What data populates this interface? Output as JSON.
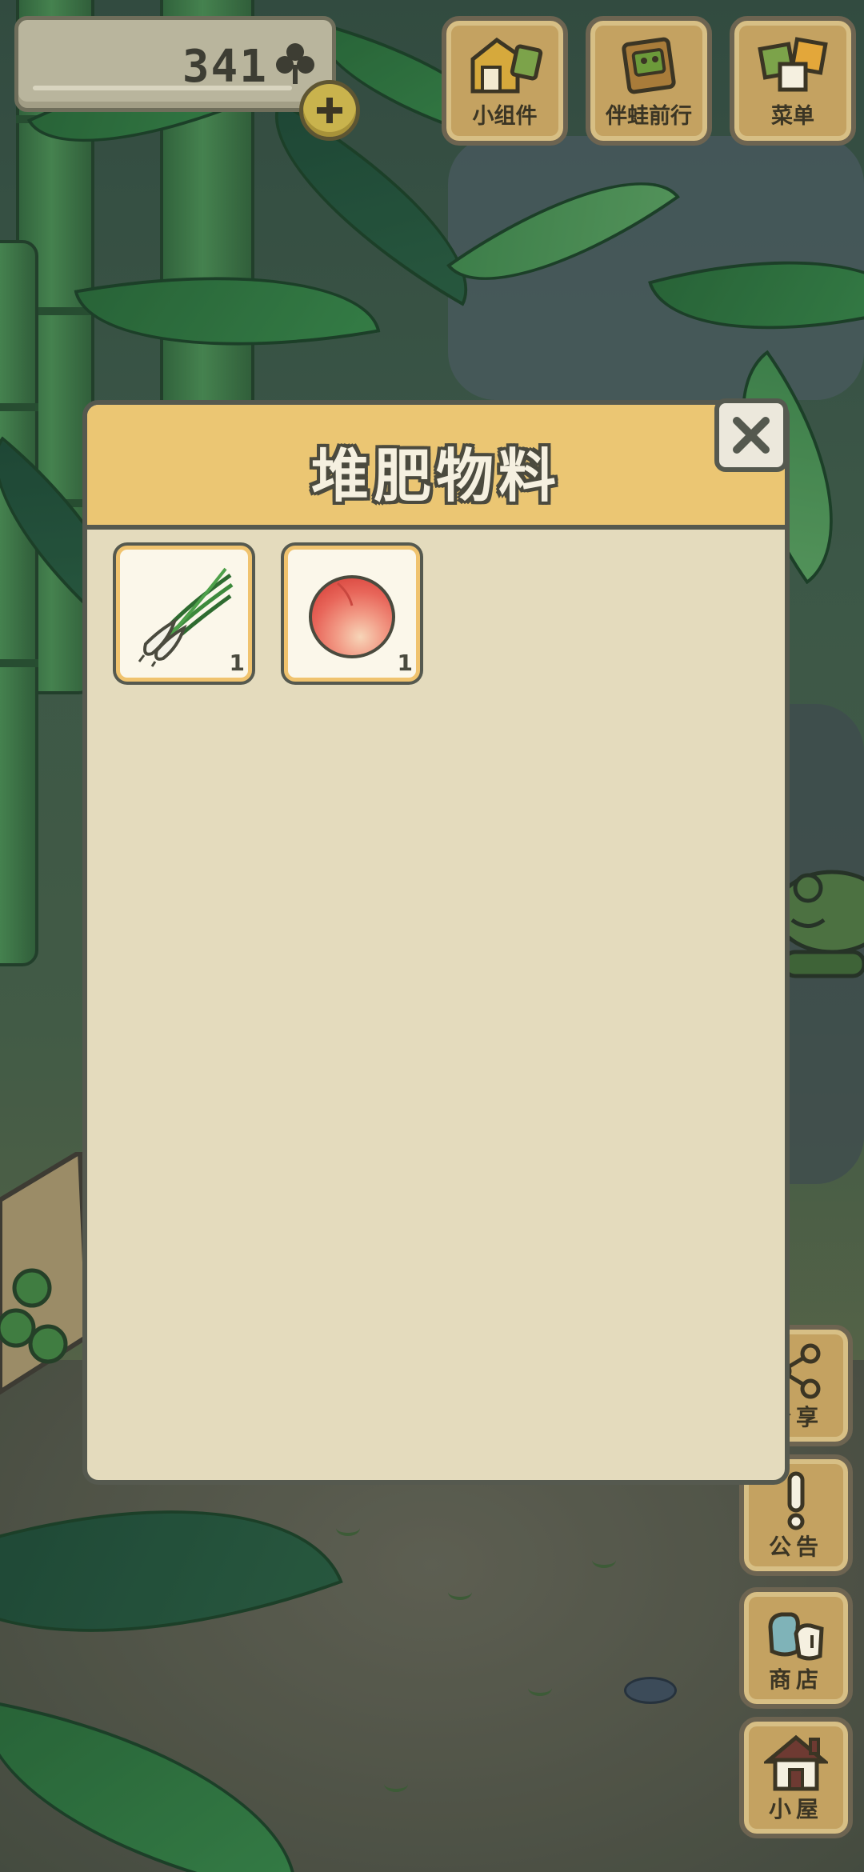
{
  "hud": {
    "clover_count": "341",
    "buttons": [
      {
        "label": "小组件",
        "icon": "widget-icon"
      },
      {
        "label": "伴蛙前行",
        "icon": "frog-companion-icon"
      },
      {
        "label": "菜单",
        "icon": "menu-icon"
      }
    ]
  },
  "side_buttons": [
    {
      "label": "分享",
      "icon": "share-icon"
    },
    {
      "label": "公告",
      "icon": "notice-icon"
    },
    {
      "label": "商店",
      "icon": "shop-icon"
    },
    {
      "label": "小屋",
      "icon": "house-icon"
    }
  ],
  "dialog": {
    "title": "堆肥物料",
    "items": [
      {
        "name": "green-onion",
        "icon": "green-onion-icon",
        "quantity": "1"
      },
      {
        "name": "peach",
        "icon": "peach-icon",
        "quantity": "1"
      }
    ]
  },
  "colors": {
    "dialog_header": "#ebc673",
    "dialog_body": "#e4dbbd",
    "dialog_border": "#55594f",
    "button_wood": "#c4a261"
  }
}
